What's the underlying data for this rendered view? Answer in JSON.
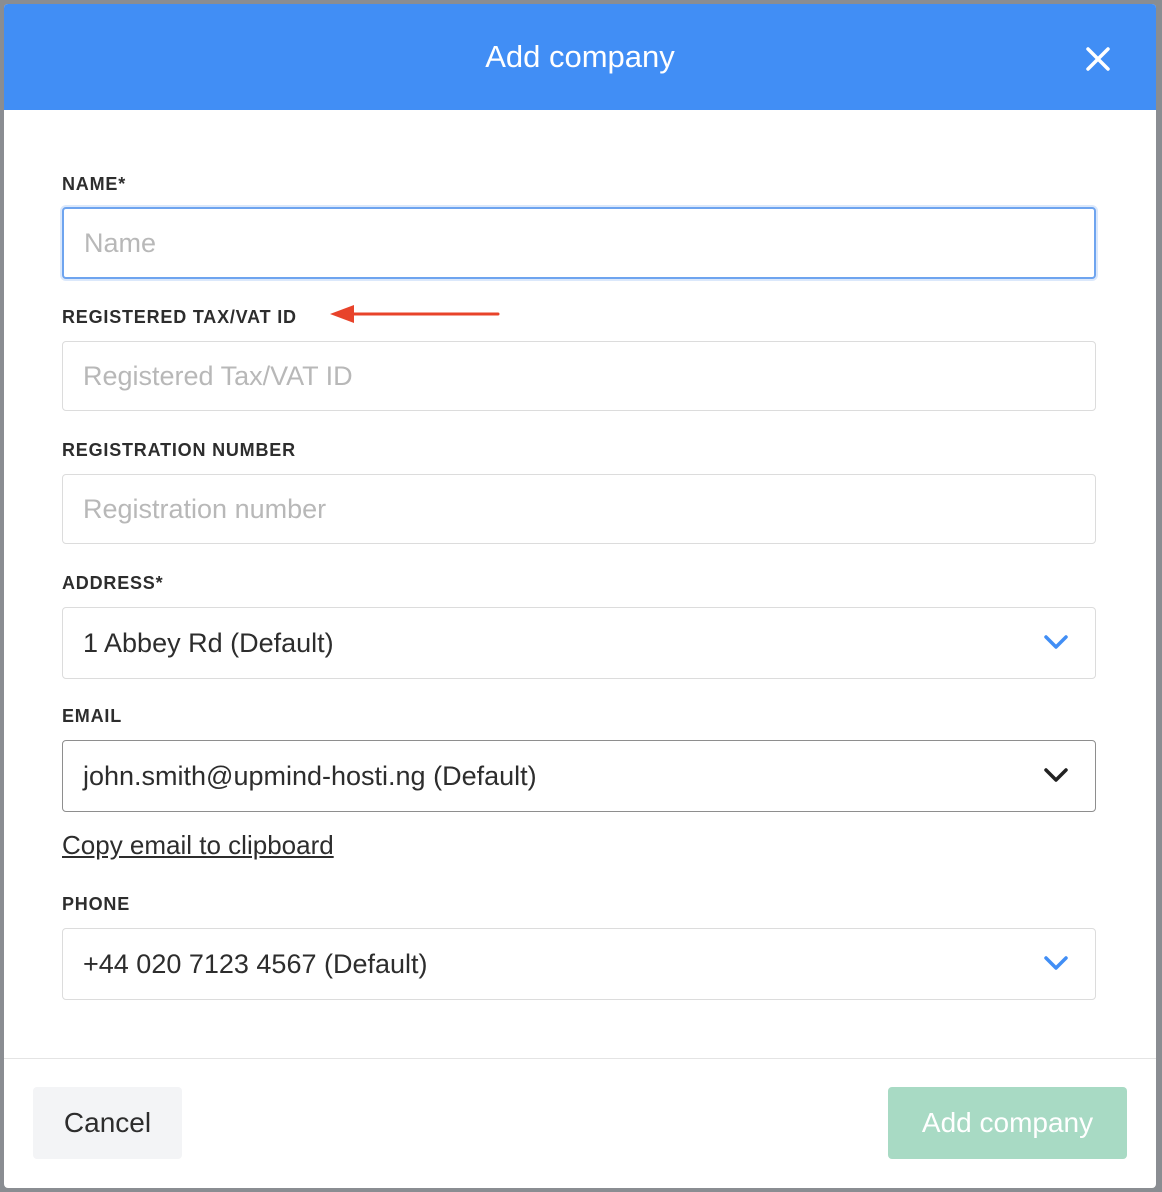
{
  "modal": {
    "title": "Add company",
    "close_icon": "close-icon"
  },
  "fields": {
    "name": {
      "label": "NAME*",
      "placeholder": "Name",
      "value": ""
    },
    "tax_id": {
      "label": "REGISTERED TAX/VAT ID",
      "placeholder": "Registered Tax/VAT ID",
      "value": ""
    },
    "registration_number": {
      "label": "REGISTRATION NUMBER",
      "placeholder": "Registration number",
      "value": ""
    },
    "address": {
      "label": "ADDRESS*",
      "selected": "1 Abbey Rd (Default)",
      "icon": "chevron-down-icon"
    },
    "email": {
      "label": "EMAIL",
      "selected": "john.smith@upmind-hosti.ng (Default)",
      "icon": "chevron-down-icon",
      "copy_link": "Copy email to clipboard"
    },
    "phone": {
      "label": "PHONE",
      "selected": "+44 020 7123 4567 (Default)",
      "icon": "chevron-down-icon"
    }
  },
  "footer": {
    "cancel_label": "Cancel",
    "submit_label": "Add company"
  },
  "colors": {
    "header": "#418ef5",
    "accent_chevron": "#418ef5",
    "submit_disabled": "#a8dac4",
    "annotation_arrow": "#e8432a"
  }
}
